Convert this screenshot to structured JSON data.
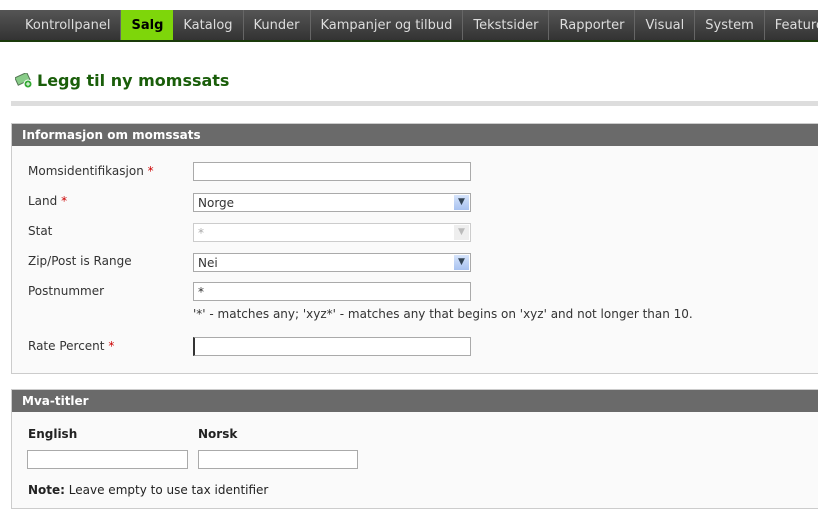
{
  "nav": [
    "Kontrollpanel",
    "Salg",
    "Katalog",
    "Kunder",
    "Kampanjer og tilbud",
    "Tekstsider",
    "Rapporter",
    "Visual",
    "System",
    "Features"
  ],
  "page_title": "Legg til ny momssats",
  "section1": {
    "title": "Informasjon om momssats",
    "fields": {
      "tax_id": {
        "label": "Momsidentifikasjon",
        "value": ""
      },
      "country": {
        "label": "Land",
        "value": "Norge"
      },
      "state": {
        "label": "Stat",
        "value": "*"
      },
      "zip_range": {
        "label": "Zip/Post is Range",
        "value": "Nei"
      },
      "postcode": {
        "label": "Postnummer",
        "value": "*",
        "hint": "'*' - matches any; 'xyz*' - matches any that begins on 'xyz' and not longer than 10."
      },
      "rate": {
        "label": "Rate Percent",
        "value": ""
      }
    },
    "required_mark": "*"
  },
  "section2": {
    "title": "Mva-titler",
    "col1": "English",
    "col2": "Norsk",
    "note_label": "Note:",
    "note": "Leave empty to use tax identifier"
  }
}
